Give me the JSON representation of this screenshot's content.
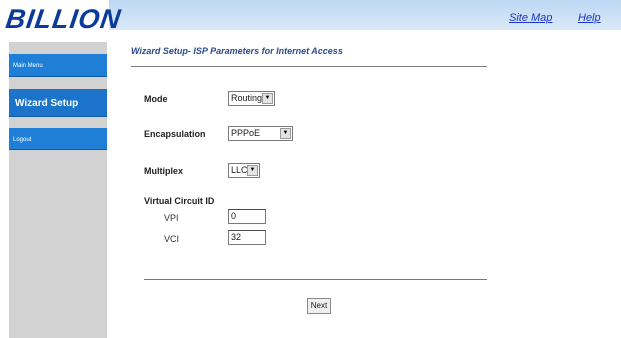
{
  "brand": {
    "logo_text": "BILLION"
  },
  "header": {
    "site_map": "Site Map",
    "help": "Help"
  },
  "sidebar": {
    "items": [
      {
        "label": "Main Menu"
      },
      {
        "label": "Wizard Setup"
      },
      {
        "label": "Logout"
      }
    ]
  },
  "main": {
    "title": "Wizard Setup- ISP Parameters for Internet Access",
    "mode": {
      "label": "Mode",
      "value": "Routing"
    },
    "encapsulation": {
      "label": "Encapsulation",
      "value": "PPPoE"
    },
    "multiplex": {
      "label": "Multiplex",
      "value": "LLC"
    },
    "vcid": {
      "label": "Virtual Circuit ID",
      "vpi_label": "VPI",
      "vpi_value": "0",
      "vci_label": "VCI",
      "vci_value": "32"
    },
    "next_label": "Next"
  },
  "colors": {
    "accent": "#1f7fd6",
    "sidebar_bg": "#d2d2d2",
    "header_bg": "#bcd7f3",
    "logo": "#0b3b9a",
    "link": "#1a33c8"
  },
  "icons": {
    "dropdown": "chevron-down-icon"
  }
}
